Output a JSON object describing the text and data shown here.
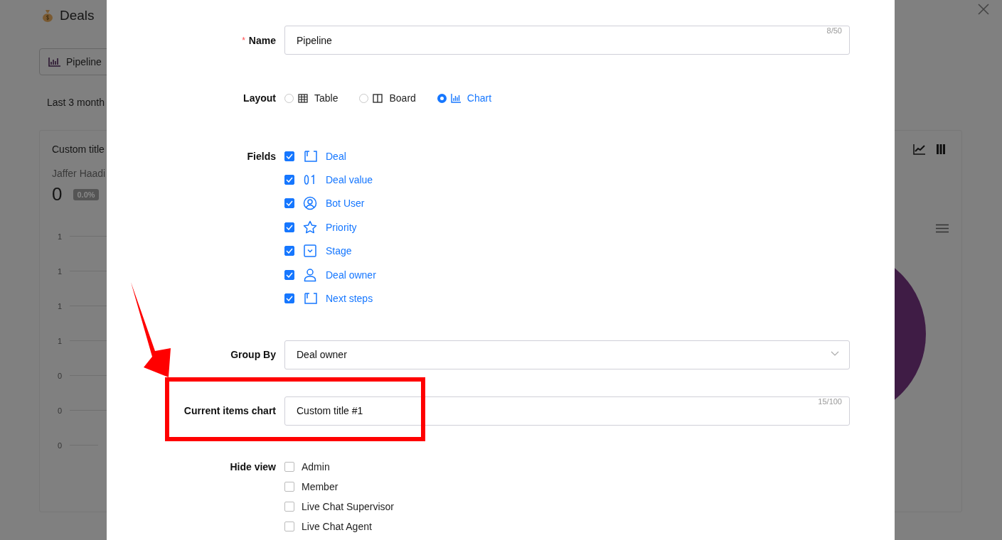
{
  "page": {
    "title": "Deals",
    "view_button": "Pipeline",
    "date_range": "Last 3 month",
    "card": {
      "title": "Custom title",
      "owner": "Jaffer Haadi",
      "value": "0",
      "change": "0.0%",
      "axis_labels": [
        "1",
        "1",
        "1",
        "1",
        "0",
        "0",
        "0"
      ]
    }
  },
  "dialog": {
    "name": {
      "label": "Name",
      "required_mark": "*",
      "value": "Pipeline",
      "counter": "8/50"
    },
    "layout": {
      "label": "Layout",
      "options": [
        {
          "label": "Table",
          "kind": "table",
          "selected": false
        },
        {
          "label": "Board",
          "kind": "board",
          "selected": false
        },
        {
          "label": "Chart",
          "kind": "chart",
          "selected": true
        }
      ]
    },
    "fields": {
      "label": "Fields",
      "items": [
        {
          "label": "Deal",
          "kind": "text",
          "checked": true
        },
        {
          "label": "Deal value",
          "kind": "number",
          "checked": true
        },
        {
          "label": "Bot User",
          "kind": "user",
          "checked": true
        },
        {
          "label": "Priority",
          "kind": "star",
          "checked": true
        },
        {
          "label": "Stage",
          "kind": "select",
          "checked": true
        },
        {
          "label": "Deal owner",
          "kind": "person",
          "checked": true
        },
        {
          "label": "Next steps",
          "kind": "text",
          "checked": true
        }
      ]
    },
    "group_by": {
      "label": "Group By",
      "value": "Deal owner"
    },
    "chart_title": {
      "label": "Current items chart",
      "value": "Custom title #1",
      "counter": "15/100"
    },
    "hide_view": {
      "label": "Hide view",
      "items": [
        {
          "label": "Admin",
          "checked": false
        },
        {
          "label": "Member",
          "checked": false
        },
        {
          "label": "Live Chat Supervisor",
          "checked": false
        },
        {
          "label": "Live Chat Agent",
          "checked": false
        }
      ]
    }
  }
}
